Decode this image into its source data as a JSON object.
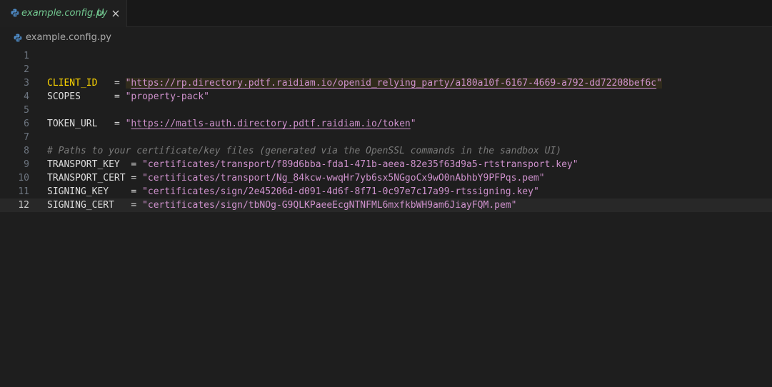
{
  "tab": {
    "icon": "python-file-icon",
    "name": "example.config.py",
    "status": "U",
    "close_icon": "close-icon"
  },
  "breadcrumb": {
    "icon": "python-file-icon",
    "label": "example.config.py"
  },
  "editor": {
    "current_line": 12,
    "lines": [
      {
        "n": "1"
      },
      {
        "n": "2"
      },
      {
        "n": "3",
        "key": "CLIENT_ID",
        "pad": "   ",
        "op": "= ",
        "q1": "\"",
        "value": "https://rp.directory.pdtf.raidiam.io/openid_relying_party/a180a10f-6167-4669-a792-dd72208bef6c",
        "q2": "\""
      },
      {
        "n": "4",
        "key": "SCOPES",
        "pad": "      ",
        "op": "= ",
        "q1": "\"",
        "value": "property-pack",
        "q2": "\""
      },
      {
        "n": "5"
      },
      {
        "n": "6",
        "key": "TOKEN_URL",
        "pad": "   ",
        "op": "= ",
        "q1": "\"",
        "value": "https://matls-auth.directory.pdtf.raidiam.io/token",
        "q2": "\""
      },
      {
        "n": "7"
      },
      {
        "n": "8",
        "comment": "# Paths to your certificate/key files (generated via the OpenSSL commands in the sandbox UI)"
      },
      {
        "n": "9",
        "key": "TRANSPORT_KEY",
        "pad": "  ",
        "op": "= ",
        "q1": "\"",
        "value": "certificates/transport/f89d6bba-fda1-471b-aeea-82e35f63d9a5-rtstransport.key",
        "q2": "\""
      },
      {
        "n": "10",
        "key": "TRANSPORT_CERT",
        "pad": " ",
        "op": "= ",
        "q1": "\"",
        "value": "certificates/transport/Ng_84kcw-wwqHr7yb6sx5NGgoCx9wO0nAbhbY9PFPqs.pem",
        "q2": "\""
      },
      {
        "n": "11",
        "key": "SIGNING_KEY",
        "pad": "    ",
        "op": "= ",
        "q1": "\"",
        "value": "certificates/sign/2e45206d-d091-4d6f-8f71-0c97e7c17a99-rtssigning.key",
        "q2": "\""
      },
      {
        "n": "12",
        "key": "SIGNING_CERT",
        "pad": "   ",
        "op": "= ",
        "q1": "\"",
        "value": "certificates/sign/tbNOg-G9QLKPaeeEcgNTNFML6mxfkbWH9am6JiayFQM.pem",
        "q2": "\""
      }
    ]
  },
  "colors": {
    "background": "#1e1e1e",
    "string": "#ce91cc",
    "untracked": "#73c991",
    "highlight": "#ffd700"
  }
}
